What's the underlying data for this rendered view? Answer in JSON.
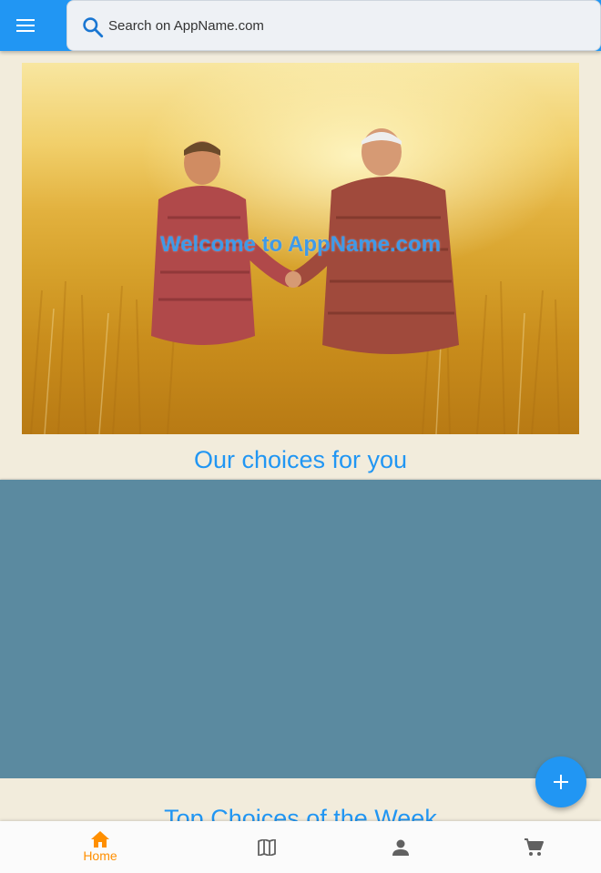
{
  "search": {
    "placeholder": "Search on AppName.com"
  },
  "hero": {
    "title": "Welcome to AppName.com"
  },
  "sections": {
    "choices_title": "Our choices for you",
    "top_week_title": "Top Choices of the Week"
  },
  "bottom_nav": {
    "items": [
      {
        "label": "Home",
        "icon": "home-icon",
        "active": true
      },
      {
        "label": "",
        "icon": "map-icon",
        "active": false
      },
      {
        "label": "",
        "icon": "person-icon",
        "active": false
      },
      {
        "label": "",
        "icon": "cart-icon",
        "active": false
      }
    ]
  },
  "colors": {
    "primary": "#2196f3",
    "accent": "#ff8f00",
    "panel": "#5b8aa0",
    "background": "#f2ecdc"
  }
}
